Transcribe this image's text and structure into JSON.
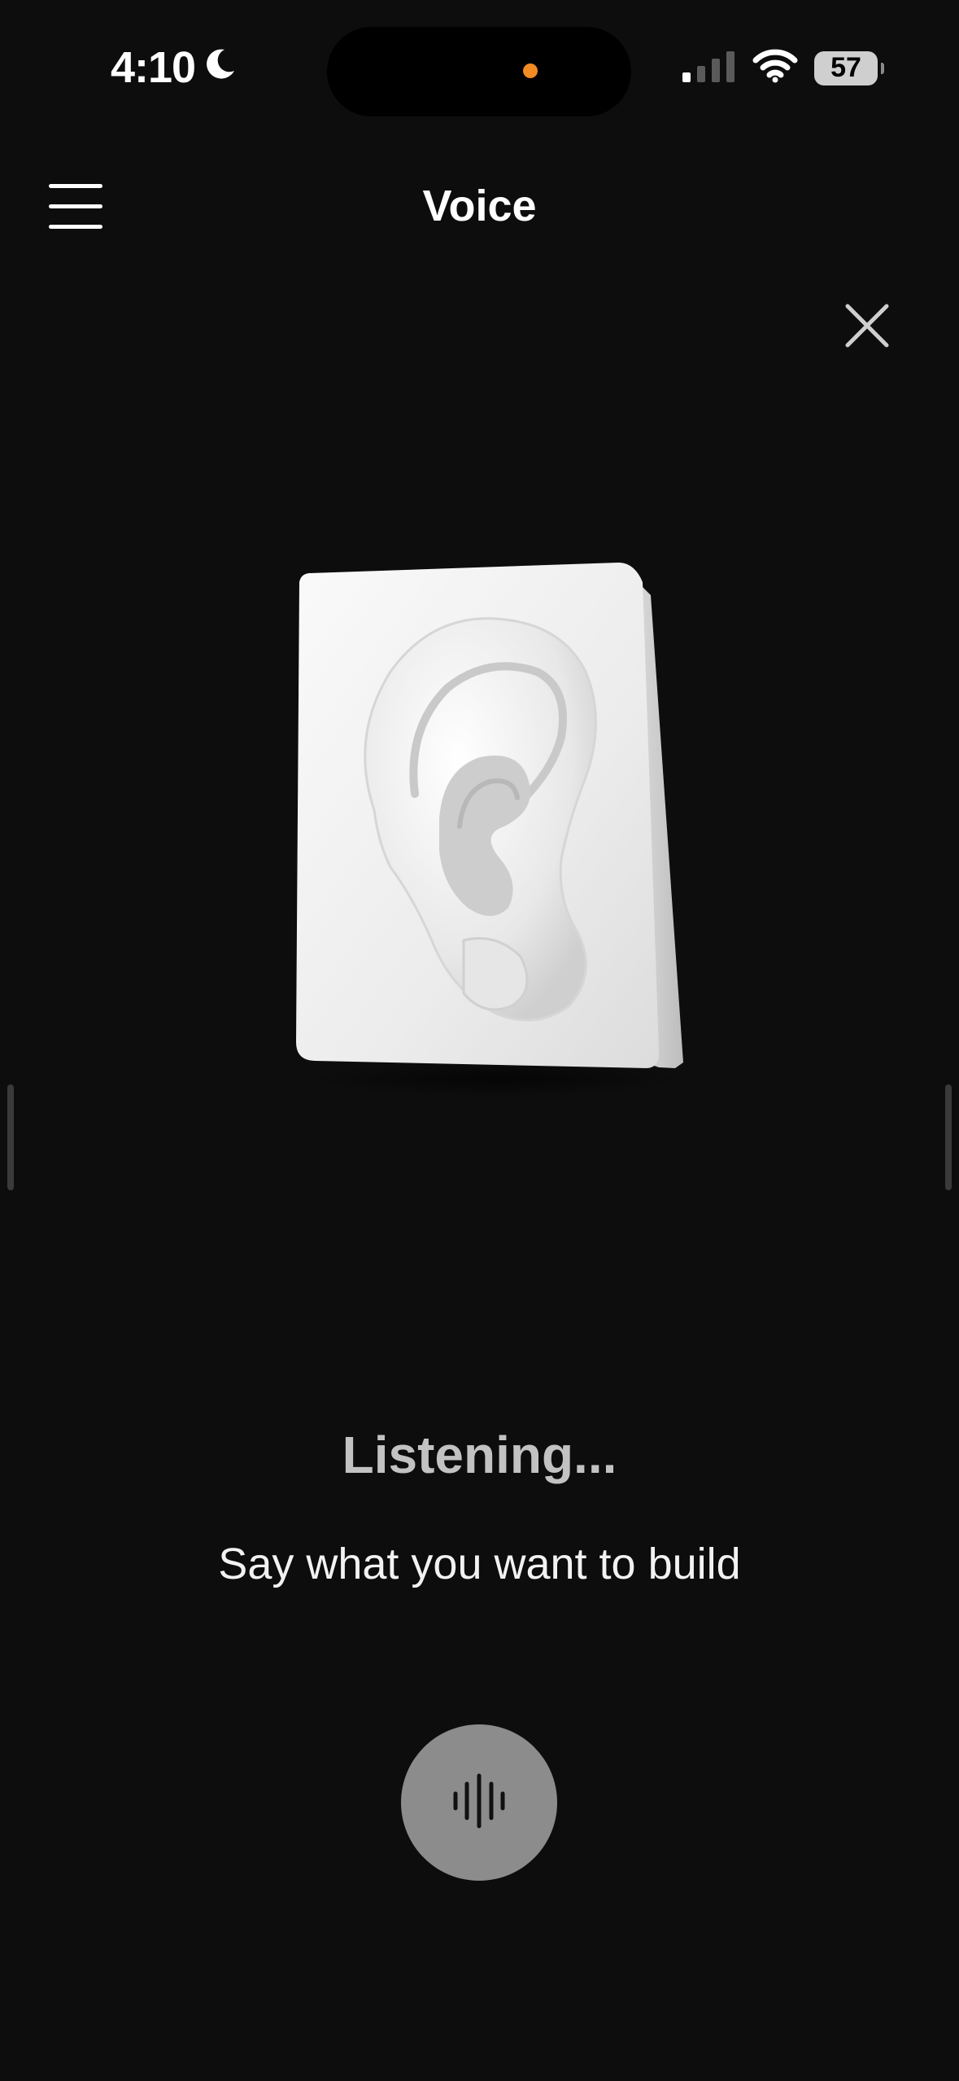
{
  "status_bar": {
    "time": "4:10",
    "battery": "57"
  },
  "header": {
    "title": "Voice"
  },
  "voice": {
    "status": "Listening...",
    "prompt": "Say what you want to build"
  },
  "icons": {
    "menu": "hamburger-menu-icon",
    "close": "close-icon",
    "mic": "waveform-icon",
    "moon": "moon-icon",
    "signal": "cellular-signal-icon",
    "wifi": "wifi-icon"
  },
  "colors": {
    "background": "#0d0d0d",
    "accent_dot": "#f28b24",
    "mic_button": "#8c8c8c"
  }
}
